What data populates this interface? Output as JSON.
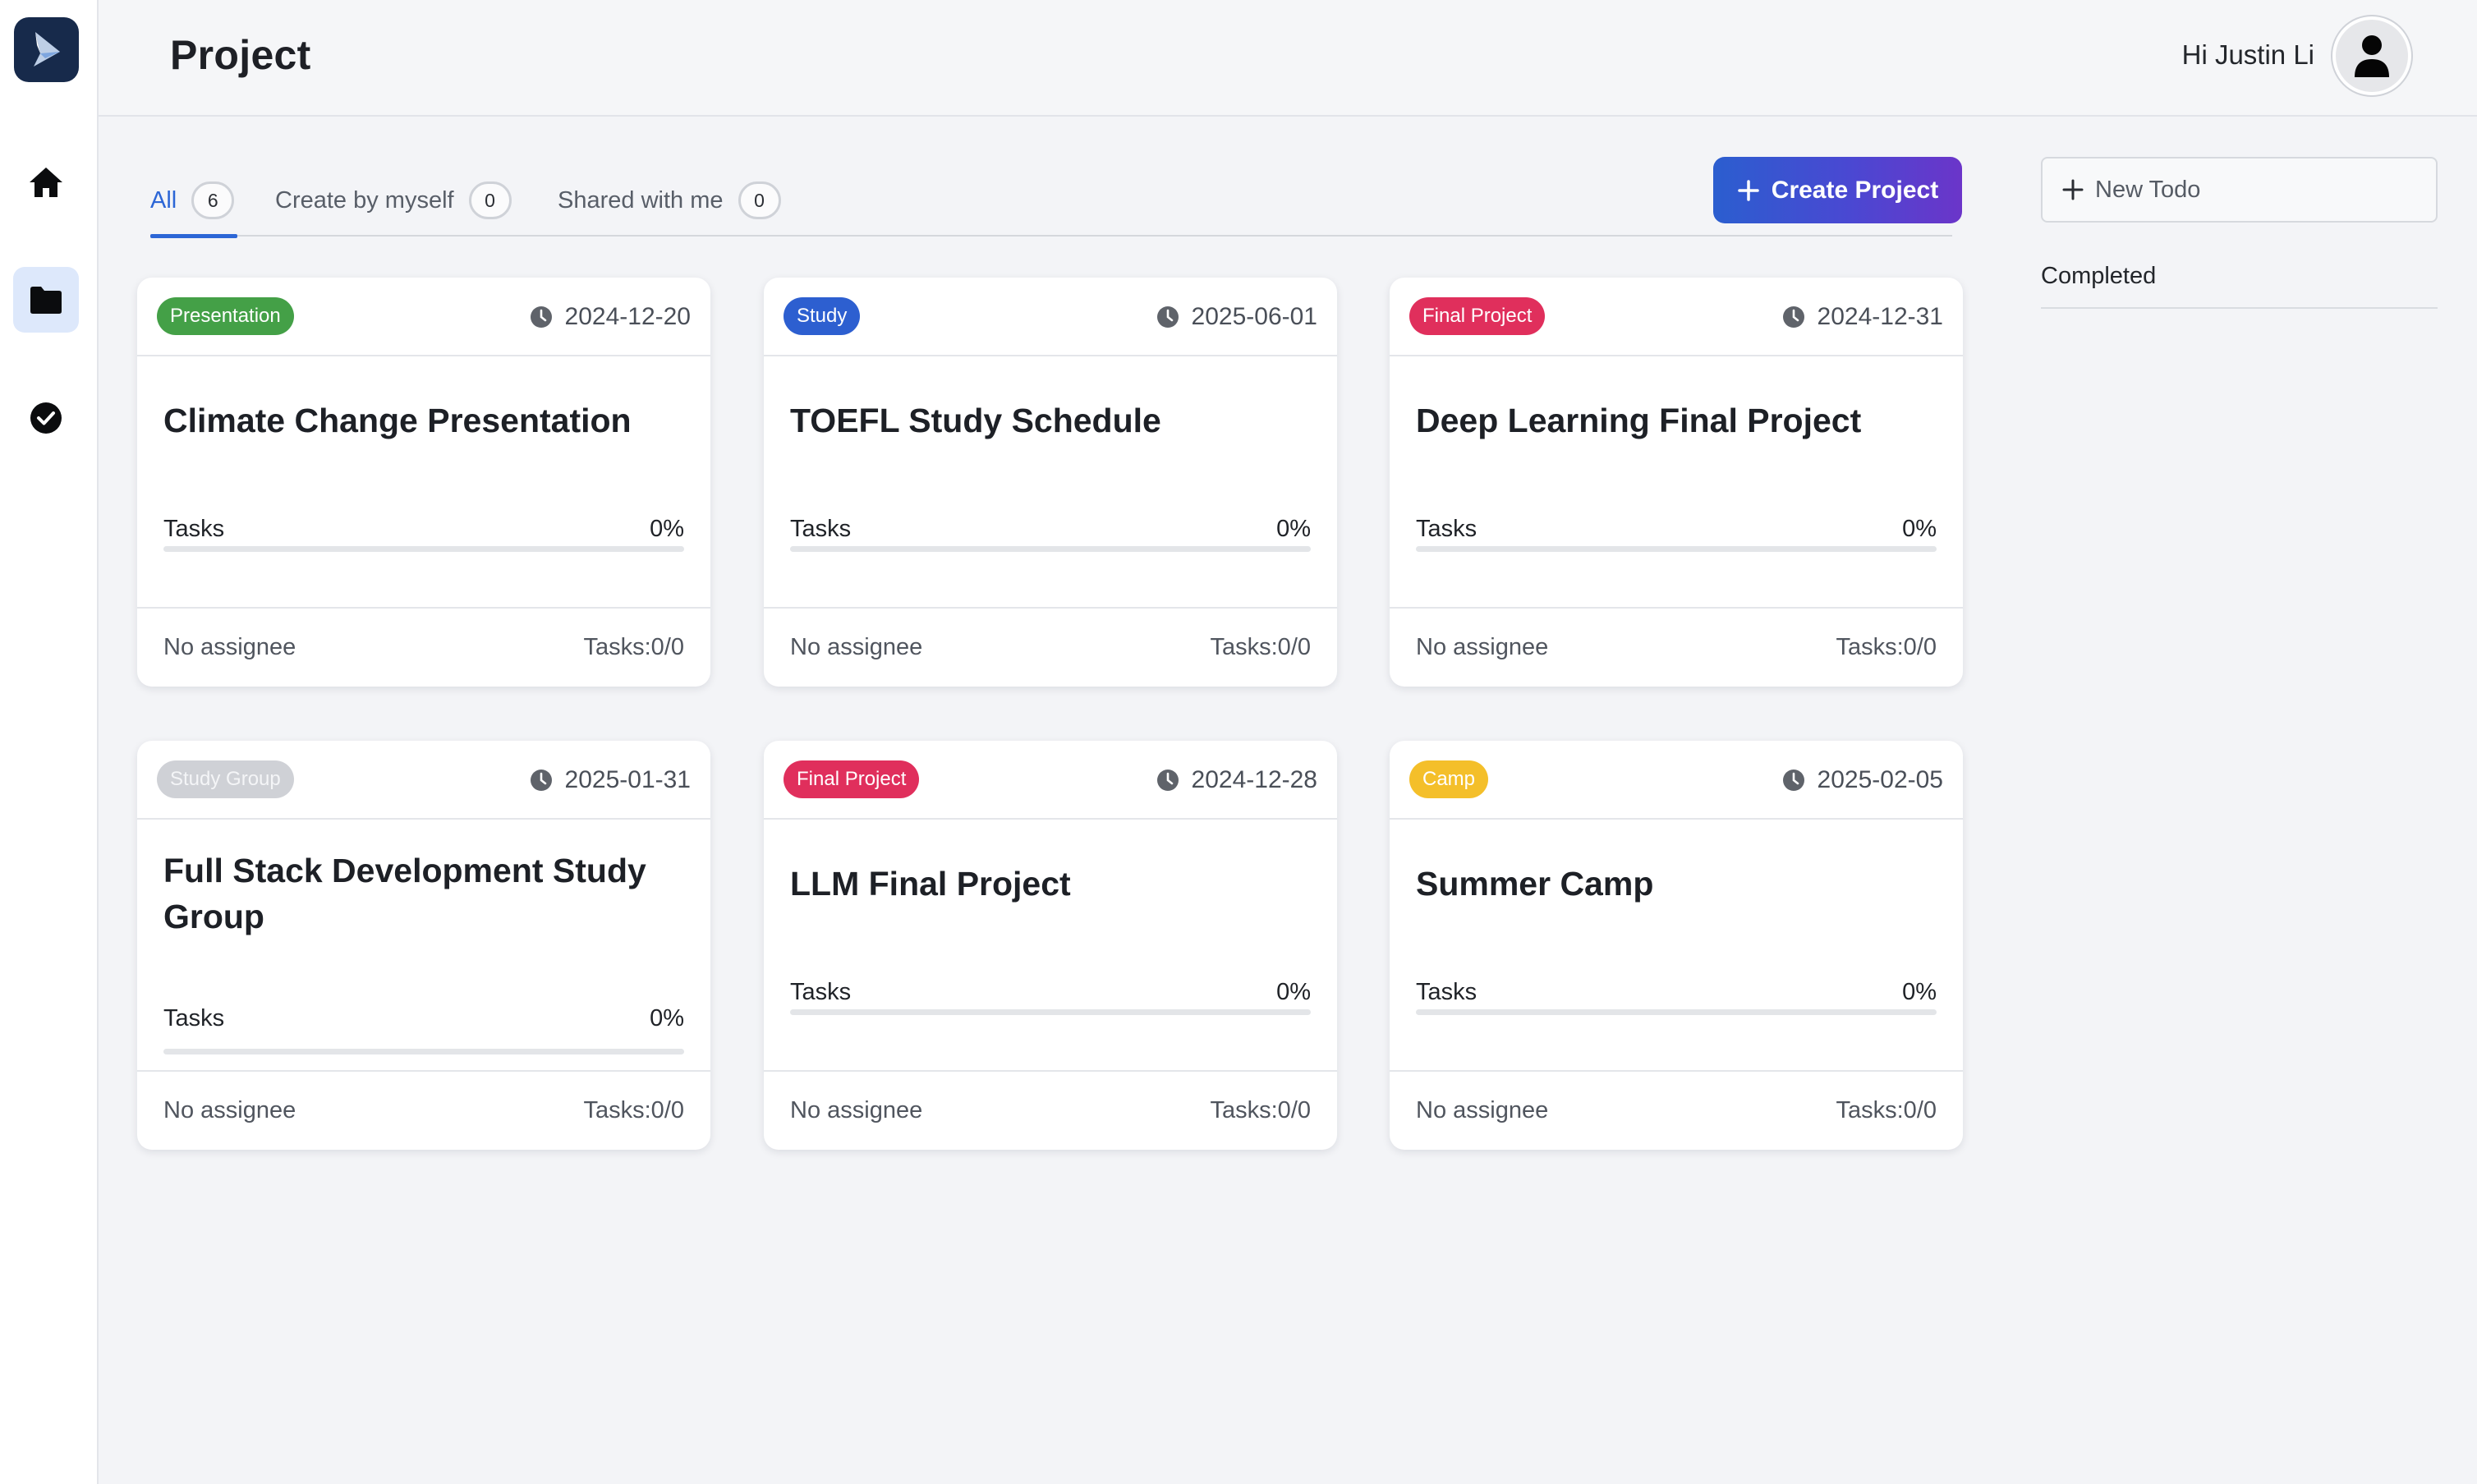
{
  "sidebar": {
    "items": [
      {
        "name": "home",
        "icon": "home-icon"
      },
      {
        "name": "projects",
        "icon": "folder-icon",
        "active": true
      },
      {
        "name": "completed",
        "icon": "check-circle-icon"
      }
    ]
  },
  "header": {
    "title": "Project",
    "greeting": "Hi Justin Li"
  },
  "tabs": [
    {
      "label": "All",
      "count": "6",
      "active": true
    },
    {
      "label": "Create by myself",
      "count": "0"
    },
    {
      "label": "Shared with me",
      "count": "0"
    }
  ],
  "create_button": {
    "label": "Create Project",
    "icon": "plus-icon"
  },
  "todo": {
    "new_placeholder": "New Todo",
    "completed_label": "Completed"
  },
  "colors": {
    "accent": "#2c66d6",
    "tag_presentation": "#44a047",
    "tag_study": "#2d5fd0",
    "tag_final": "#e02f5c",
    "tag_study_group": "#cfd1d6",
    "tag_camp": "#f4bf2a"
  },
  "projects": [
    {
      "tag": "Presentation",
      "tag_color": "#44a047",
      "due": "2024-12-20",
      "title": "Climate Change Presentation",
      "tasks_label": "Tasks",
      "percent": "0%",
      "progress": 0,
      "assignee": "No assignee",
      "task_count": "Tasks:0/0"
    },
    {
      "tag": "Study",
      "tag_color": "#2d5fd0",
      "due": "2025-06-01",
      "title": "TOEFL Study Schedule",
      "tasks_label": "Tasks",
      "percent": "0%",
      "progress": 0,
      "assignee": "No assignee",
      "task_count": "Tasks:0/0"
    },
    {
      "tag": "Final Project",
      "tag_color": "#e02f5c",
      "due": "2024-12-31",
      "title": "Deep Learning Final Project",
      "tasks_label": "Tasks",
      "percent": "0%",
      "progress": 0,
      "assignee": "No assignee",
      "task_count": "Tasks:0/0"
    },
    {
      "tag": "Study Group",
      "tag_color": "#cfd1d6",
      "due": "2025-01-31",
      "title": "Full Stack Development Study Group",
      "tasks_label": "Tasks",
      "percent": "0%",
      "progress": 0,
      "assignee": "No assignee",
      "task_count": "Tasks:0/0"
    },
    {
      "tag": "Final Project",
      "tag_color": "#e02f5c",
      "due": "2024-12-28",
      "title": "LLM Final Project",
      "tasks_label": "Tasks",
      "percent": "0%",
      "progress": 0,
      "assignee": "No assignee",
      "task_count": "Tasks:0/0"
    },
    {
      "tag": "Camp",
      "tag_color": "#f4bf2a",
      "due": "2025-02-05",
      "title": "Summer Camp",
      "tasks_label": "Tasks",
      "percent": "0%",
      "progress": 0,
      "assignee": "No assignee",
      "task_count": "Tasks:0/0"
    }
  ]
}
